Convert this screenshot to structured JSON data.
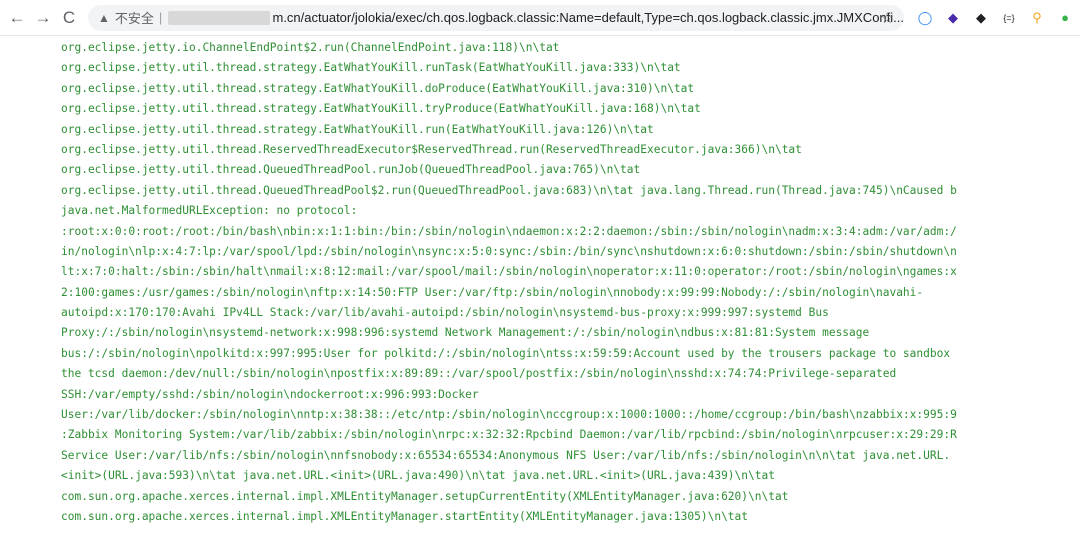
{
  "browser": {
    "back_icon": "←",
    "forward_icon": "→",
    "reload_icon": "C",
    "security_warning_icon": "▲",
    "security_label": "不安全",
    "separator": "|",
    "url": "m.cn/actuator/jolokia/exec/ch.qos.logback.classic:Name=default,Type=ch.qos.logback.classic.jmx.JMXConfi...",
    "bookmark_icon": "☆",
    "extensions": [
      {
        "name": "ring-extension-icon",
        "glyph": "◯",
        "color": "#2b84f0"
      },
      {
        "name": "diamond-extension-icon",
        "glyph": "◆",
        "color": "#4b2ca8"
      },
      {
        "name": "diamond-dark-extension-icon",
        "glyph": "◆",
        "color": "#202124"
      },
      {
        "name": "braces-extension-icon",
        "glyph": "{=}",
        "color": "#202124"
      },
      {
        "name": "pin-extension-icon",
        "glyph": "⚲",
        "color": "#f4a522"
      },
      {
        "name": "leaf-extension-icon",
        "glyph": "●",
        "color": "#3cb34a"
      }
    ]
  },
  "log_lines": [
    "org.eclipse.jetty.io.ChannelEndPoint$2.run(ChannelEndPoint.java:118)\\n\\tat",
    "org.eclipse.jetty.util.thread.strategy.EatWhatYouKill.runTask(EatWhatYouKill.java:333)\\n\\tat",
    "org.eclipse.jetty.util.thread.strategy.EatWhatYouKill.doProduce(EatWhatYouKill.java:310)\\n\\tat",
    "org.eclipse.jetty.util.thread.strategy.EatWhatYouKill.tryProduce(EatWhatYouKill.java:168)\\n\\tat",
    "org.eclipse.jetty.util.thread.strategy.EatWhatYouKill.run(EatWhatYouKill.java:126)\\n\\tat",
    "org.eclipse.jetty.util.thread.ReservedThreadExecutor$ReservedThread.run(ReservedThreadExecutor.java:366)\\n\\tat",
    "org.eclipse.jetty.util.thread.QueuedThreadPool.runJob(QueuedThreadPool.java:765)\\n\\tat",
    "org.eclipse.jetty.util.thread.QueuedThreadPool$2.run(QueuedThreadPool.java:683)\\n\\tat java.lang.Thread.run(Thread.java:745)\\nCaused b",
    "java.net.MalformedURLException: no protocol:",
    ":root:x:0:0:root:/root:/bin/bash\\nbin:x:1:1:bin:/bin:/sbin/nologin\\ndaemon:x:2:2:daemon:/sbin:/sbin/nologin\\nadm:x:3:4:adm:/var/adm:/",
    "in/nologin\\nlp:x:4:7:lp:/var/spool/lpd:/sbin/nologin\\nsync:x:5:0:sync:/sbin:/bin/sync\\nshutdown:x:6:0:shutdown:/sbin:/sbin/shutdown\\n",
    "lt:x:7:0:halt:/sbin:/sbin/halt\\nmail:x:8:12:mail:/var/spool/mail:/sbin/nologin\\noperator:x:11:0:operator:/root:/sbin/nologin\\ngames:x",
    "2:100:games:/usr/games:/sbin/nologin\\nftp:x:14:50:FTP User:/var/ftp:/sbin/nologin\\nnobody:x:99:99:Nobody:/:/sbin/nologin\\navahi-",
    "autoipd:x:170:170:Avahi IPv4LL Stack:/var/lib/avahi-autoipd:/sbin/nologin\\nsystemd-bus-proxy:x:999:997:systemd Bus",
    "Proxy:/:/sbin/nologin\\nsystemd-network:x:998:996:systemd Network Management:/:/sbin/nologin\\ndbus:x:81:81:System message",
    "bus:/:/sbin/nologin\\npolkitd:x:997:995:User for polkitd:/:/sbin/nologin\\ntss:x:59:59:Account used by the trousers package to sandbox",
    "the tcsd daemon:/dev/null:/sbin/nologin\\npostfix:x:89:89::/var/spool/postfix:/sbin/nologin\\nsshd:x:74:74:Privilege-separated",
    "SSH:/var/empty/sshd:/sbin/nologin\\ndockerroot:x:996:993:Docker",
    "User:/var/lib/docker:/sbin/nologin\\nntp:x:38:38::/etc/ntp:/sbin/nologin\\nccgroup:x:1000:1000::/home/ccgroup:/bin/bash\\nzabbix:x:995:9",
    ":Zabbix Monitoring System:/var/lib/zabbix:/sbin/nologin\\nrpc:x:32:32:Rpcbind Daemon:/var/lib/rpcbind:/sbin/nologin\\nrpcuser:x:29:29:R",
    "Service User:/var/lib/nfs:/sbin/nologin\\nnfsnobody:x:65534:65534:Anonymous NFS User:/var/lib/nfs:/sbin/nologin\\n\\n\\tat java.net.URL.",
    "<init>(URL.java:593)\\n\\tat java.net.URL.<init>(URL.java:490)\\n\\tat java.net.URL.<init>(URL.java:439)\\n\\tat",
    "com.sun.org.apache.xerces.internal.impl.XMLEntityManager.setupCurrentEntity(XMLEntityManager.java:620)\\n\\tat",
    "com.sun.org.apache.xerces.internal.impl.XMLEntityManager.startEntity(XMLEntityManager.java:1305)\\n\\tat"
  ]
}
